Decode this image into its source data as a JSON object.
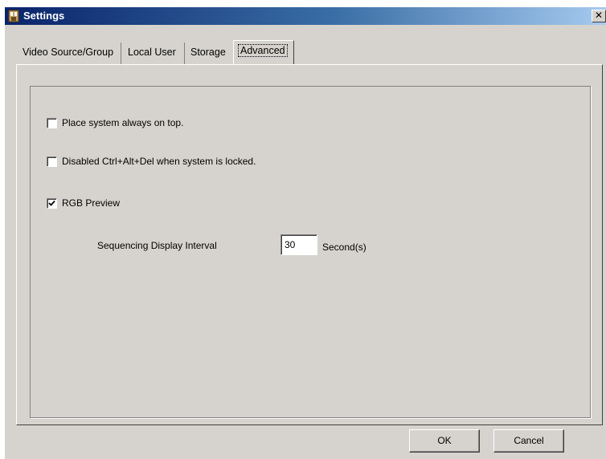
{
  "window": {
    "title": "Settings",
    "close_glyph": "✕",
    "icon": "settings-app-icon"
  },
  "tabs": [
    {
      "label": "Video Source/Group"
    },
    {
      "label": "Local User"
    },
    {
      "label": "Storage"
    },
    {
      "label": "Advanced",
      "active": true
    }
  ],
  "advanced": {
    "always_on_top": {
      "label": "Place system always on top.",
      "checked": false
    },
    "disable_ctrl_alt_del": {
      "label": "Disabled Ctrl+Alt+Del when system is locked.",
      "checked": false
    },
    "rgb_preview": {
      "label": "RGB Preview",
      "checked": true
    },
    "sequencing": {
      "label": "Sequencing Display Interval",
      "value": "30",
      "unit": "Second(s)"
    }
  },
  "buttons": {
    "ok": "OK",
    "cancel": "Cancel"
  },
  "colors": {
    "face": "#d6d3ce",
    "titlebar_start": "#0a246a",
    "titlebar_end": "#a6caf0"
  }
}
